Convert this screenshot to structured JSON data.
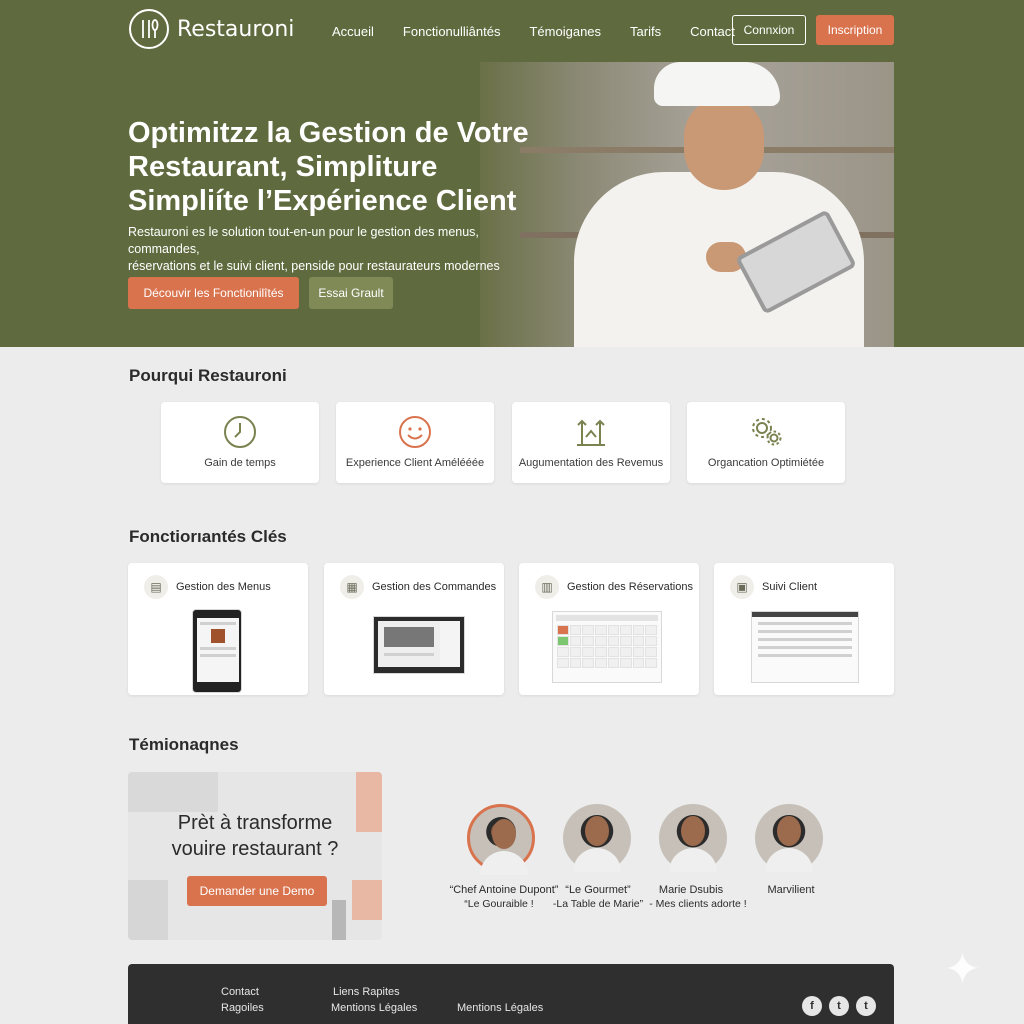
{
  "header": {
    "brand": "Restauroni",
    "nav": [
      "Accueil",
      "Fonctionulliântés",
      "Témoiganes",
      "Tarifs",
      "Contact"
    ],
    "login_label": "Connxion",
    "signup_label": "Inscription"
  },
  "hero": {
    "title_lines": [
      "Optimitzz la Gestion de Votre",
      "Restaurant, Simpliture",
      "Simpliíte l’Expérience Client"
    ],
    "subtitle_lines": [
      "Restauroni es le solution tout-en-un pour le gestion des menus, commandes,",
      "réservations et le suivi client, penside pour restaurateurs modernes"
    ],
    "discover_label": "Découvir les Fonctionilîtés",
    "trial_label": "Essai Grault"
  },
  "why": {
    "title": "Pourqui Restauroni",
    "items": [
      {
        "label": "Gain de temps",
        "icon": "clock-icon"
      },
      {
        "label": "Experience Client Amélééée",
        "icon": "smiley-icon"
      },
      {
        "label": "Augumentation des Revemus",
        "icon": "growth-arrows-icon"
      },
      {
        "label": "Organcation Optimiétée",
        "icon": "gears-icon"
      }
    ]
  },
  "features": {
    "title": "Fonctiorıantés Clés",
    "items": [
      {
        "label": "Gestion des Menus",
        "icon": "menu-icon"
      },
      {
        "label": "Gestion des Commandes",
        "icon": "orders-icon"
      },
      {
        "label": "Gestion des Réservations",
        "icon": "calendar-icon"
      },
      {
        "label": "Suivi Client",
        "icon": "client-icon"
      }
    ]
  },
  "testimonials": {
    "title": "Témionaqnes",
    "cta_lines": [
      "Prèt à transforme",
      "vouire restaurant ?"
    ],
    "cta_button": "Demander une Demo",
    "people": [
      {
        "name": "“Chef Antoine Dupont”",
        "quote": "“Le Gouraible !"
      },
      {
        "name": "“Le Gourmet”",
        "quote": "-La Table de Marie”"
      },
      {
        "name": "Marie Dsubis",
        "quote": "- Mes clients adorte !"
      },
      {
        "name": "Marvilient",
        "quote": ""
      }
    ]
  },
  "footer": {
    "col1": [
      "Contact",
      "Ragoiles"
    ],
    "col2": [
      "Liens Rapites",
      "Mentions Légales"
    ],
    "col3": "Mentions Légales",
    "social_icons": [
      "facebook-icon",
      "twitter-icon",
      "twitter-icon"
    ]
  },
  "colors": {
    "olive": "#5f6b3e",
    "accent": "#d9734e",
    "trial": "#7f8a57",
    "footer": "#2f2f2f"
  }
}
